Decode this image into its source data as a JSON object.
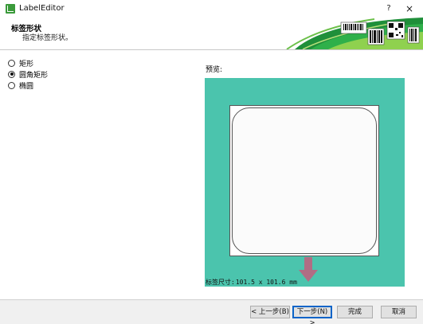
{
  "window": {
    "title": "LabelEditor",
    "help": "?",
    "close": "×"
  },
  "header": {
    "title": "标签形状",
    "subtitle": "指定标签形状。"
  },
  "shape_options": [
    {
      "label": "矩形",
      "checked": false
    },
    {
      "label": "圆角矩形",
      "checked": true
    },
    {
      "label": "椭圆",
      "checked": false
    }
  ],
  "preview": {
    "label": "预览:",
    "size_label": "标签尺寸:",
    "size_value": "101.5 x 101.6 mm"
  },
  "buttons": {
    "back": "< 上一步(B)",
    "next": "下一步(N) >",
    "finish": "完成",
    "cancel": "取消"
  },
  "colors": {
    "preview_bg": "#4bc4ad",
    "arrow": "#b06d84",
    "accent_green": "#3a9a3a"
  }
}
